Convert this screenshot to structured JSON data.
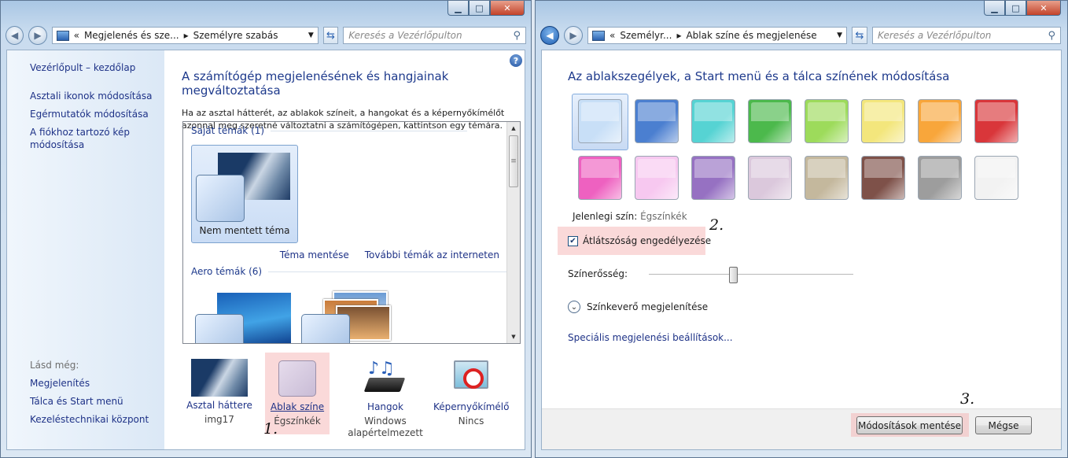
{
  "left": {
    "address": {
      "crumb1": "Megjelenés és sze...",
      "crumb2": "Személyre szabás"
    },
    "search": {
      "placeholder": "Keresés a Vezérlőpulton"
    },
    "sidebar": {
      "home": "Vezérlőpult – kezdőlap",
      "items": [
        "Asztali ikonok módosítása",
        "Egérmutatók módosítása",
        "A fiókhoz tartozó kép módosítása"
      ],
      "see_also_label": "Lásd még:",
      "see_also": [
        "Megjelenítés",
        "Tálca és Start menü",
        "Kezeléstechnikai központ"
      ]
    },
    "title": "A számítógép megjelenésének és hangjainak megváltoztatása",
    "description": "Ha az asztal hátterét, az ablakok színeit, a hangokat és a képernyőkímélőt azonnal meg szeretné változtatni a számítógépen, kattintson egy témára.",
    "my_themes": "Saját témák (1)",
    "unsaved_theme": "Nem mentett téma",
    "save_theme": "Téma mentése",
    "more_themes": "További témák az interneten",
    "aero_themes": "Aero témák (6)",
    "bottom": [
      {
        "label": "Asztal háttere",
        "sub": "img17"
      },
      {
        "label": "Ablak színe",
        "sub": "Égszínkék"
      },
      {
        "label": "Hangok",
        "sub": "Windows alapértelmezett"
      },
      {
        "label": "Képernyőkímélő",
        "sub": "Nincs"
      }
    ],
    "step": "1."
  },
  "right": {
    "address": {
      "crumb1": "Személyr...",
      "crumb2": "Ablak színe és megjelenése"
    },
    "search": {
      "placeholder": "Keresés a Vezérlőpulton"
    },
    "title": "Az ablakszegélyek, a Start menü és a tálca színének módosítása",
    "swatch_colors": [
      [
        "#c8dff7",
        "#4b7fd0",
        "#56d3d3",
        "#4cb94c",
        "#9ddb5b",
        "#f3e67c",
        "#f8a63b",
        "#d9363a"
      ],
      [
        "#ee61c0",
        "#f7c8f0",
        "#9671c2",
        "#dbc8dc",
        "#c4b89d",
        "#7e5149",
        "#9d9d9d",
        "#f2f2f2"
      ]
    ],
    "current_label": "Jelenlegi szín:",
    "current_value": "Égszínkék",
    "transparency": "Átlátszóság engedélyezése",
    "intensity": 0.41,
    "intensity_label": "Színerősség:",
    "mixer": "Színkeverő megjelenítése",
    "advanced": "Speciális megjelenési beállítások...",
    "save_btn": "Módosítások mentése",
    "cancel_btn": "Mégse",
    "step2": "2.",
    "step3": "3."
  }
}
